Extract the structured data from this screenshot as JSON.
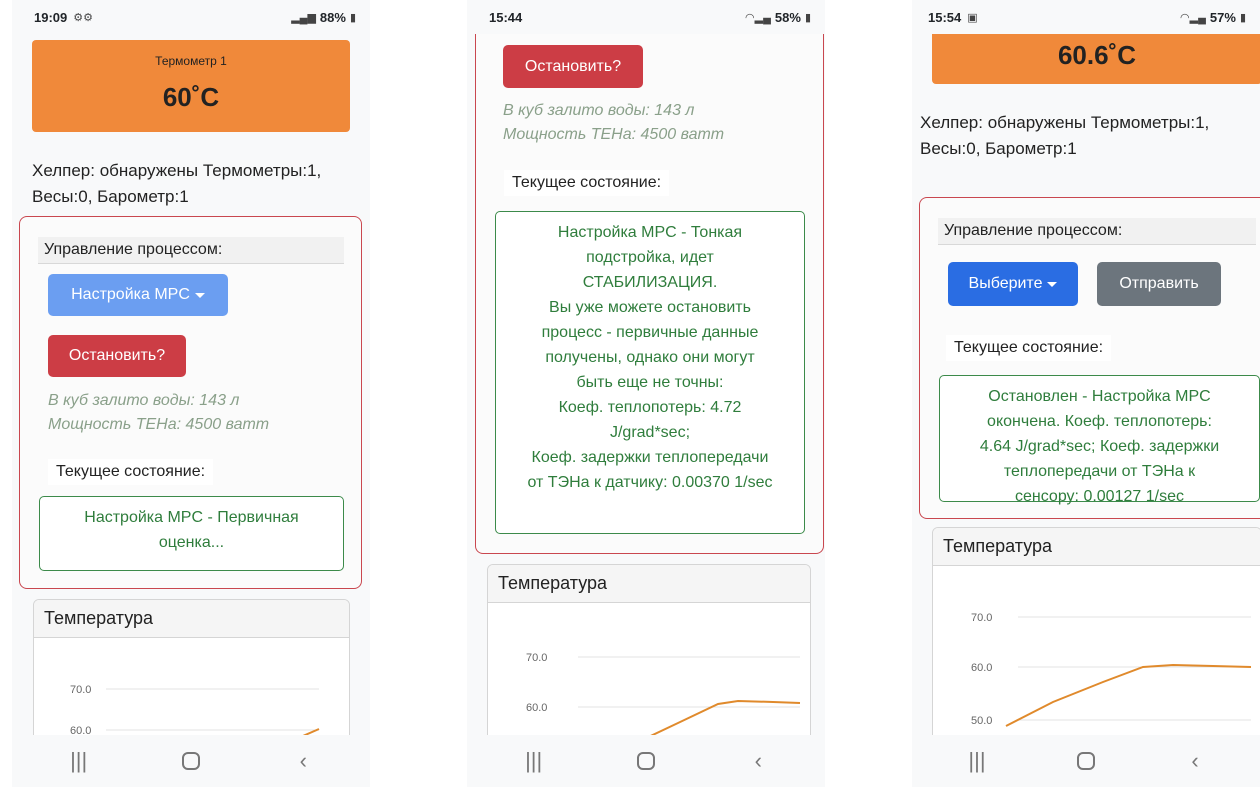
{
  "phone1": {
    "status": {
      "time": "19:09",
      "battery": "88%"
    },
    "thermo": {
      "name": "Термометр 1",
      "temp": "60˚C"
    },
    "helper": {
      "line1": "Хелпер: обнаружены Термометры:1,",
      "line2": "Весы:0, Барометр:1"
    },
    "control_title": "Управление процессом:",
    "mode_button": "Настройка MPC",
    "stop_button": "Остановить?",
    "info": {
      "water": "В куб залито воды: 143 л",
      "power": "Мощность ТЕНа: 4500 ватт"
    },
    "state_label": "Текущее состояние:",
    "state": {
      "line1": "Настройка MPC - Первичная",
      "line2": "оценка..."
    },
    "chart_title": "Температура",
    "chart_ticks": [
      "70.0",
      "60.0"
    ]
  },
  "phone2": {
    "status": {
      "time": "15:44",
      "battery": "58%"
    },
    "stop_button": "Остановить?",
    "info": {
      "water": "В куб залито воды: 143 л",
      "power": "Мощность ТЕНа: 4500 ватт"
    },
    "state_label": "Текущее состояние:",
    "state_lines": [
      "Настройка MPC - Тонкая",
      "подстройка, идет",
      "СТАБИЛИЗАЦИЯ.",
      "Вы уже можете остановить",
      "процесс - первичные данные",
      "получены, однако они могут",
      "быть еще не точны:",
      "Коеф. теплопотерь: 4.72",
      "J/grad*sec;",
      "Коеф. задержки теплопередачи",
      "от ТЭНа к датчику: 0.00370 1/sec"
    ],
    "chart_title": "Температура",
    "chart_ticks": [
      "70.0",
      "60.0"
    ]
  },
  "phone3": {
    "status": {
      "time": "15:54",
      "battery": "57%"
    },
    "thermo": {
      "temp": "60.6˚C"
    },
    "helper": {
      "line1": "Хелпер: обнаружены Термометры:1,",
      "line2": "Весы:0, Барометр:1"
    },
    "control_title": "Управление процессом:",
    "select_button": "Выберите",
    "send_button": "Отправить",
    "state_label": "Текущее состояние:",
    "state_lines": [
      "Остановлен - Настройка MPC",
      "окончена. Коеф. теплопотерь:",
      "4.64 J/grad*sec; Коеф. задержки",
      "теплопередачи от ТЭНа к",
      "сенсору: 0.00127 1/sec"
    ],
    "chart_title": "Температура",
    "chart_ticks": [
      "70.0",
      "60.0",
      "50.0"
    ]
  },
  "colors": {
    "thermo": "#f0893a",
    "card_border": "#c9474f",
    "state_green": "#2f7d3c",
    "line": "#e08a2c"
  }
}
